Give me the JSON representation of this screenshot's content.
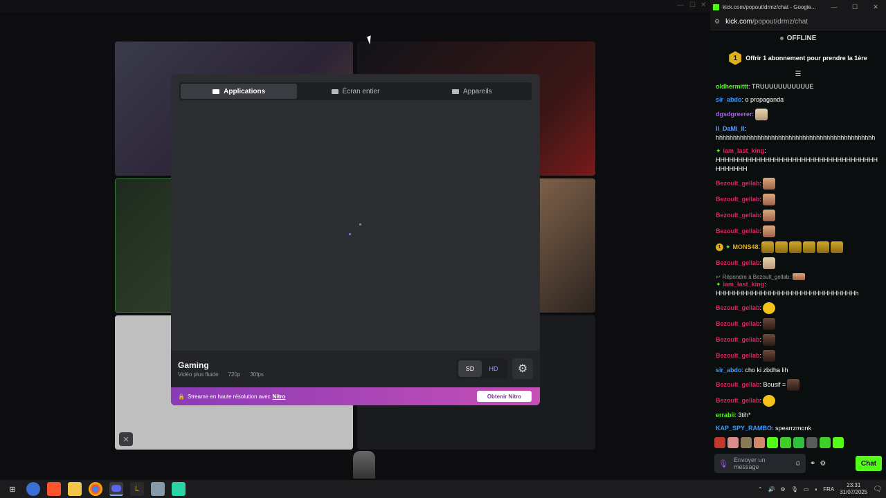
{
  "screen_share": {
    "tabs": [
      {
        "label": "Applications",
        "icon": "window-icon",
        "active": true
      },
      {
        "label": "Écran entier",
        "icon": "monitor-icon",
        "active": false
      },
      {
        "label": "Appareils",
        "icon": "camera-icon",
        "active": false
      }
    ],
    "preset": {
      "title": "Gaming",
      "subtitle": "Vidéo plus fluide",
      "resolution": "720p",
      "fps": "30fps"
    },
    "quality": {
      "sd": "SD",
      "hd": "HD",
      "selected": "SD"
    },
    "nitro": {
      "text": "Streame en haute résolution avec",
      "link": "Nitro",
      "button": "Obtenir Nitro"
    }
  },
  "chat_window": {
    "title": "kick.com/popout/drmz/chat - Google...",
    "url_host": "kick.com",
    "url_path": "/popout/drmz/chat",
    "status": "OFFLINE",
    "sub_banner": {
      "badge": "1",
      "text": "Offrir 1 abonnement pour prendre la 1ère"
    },
    "messages": [
      {
        "user": "oldhermittt",
        "color": "#53fc18",
        "text": "TRUUUUUUUUUUUE"
      },
      {
        "user": "sir_abdo",
        "color": "#3b9bff",
        "text": "o propaganda"
      },
      {
        "user": "dgsdgreerer",
        "color": "#b05cff",
        "text": ""
      },
      {
        "user": "II_DaMi_II",
        "color": "#5b9bff",
        "text": "hhhhhhhhhhhhhhhhhhhhhhhhhhhhhhhhhhhhhhhhhhhhhh"
      },
      {
        "user": "iam_last_king",
        "color": "#e0245e",
        "text": "HHHHHHHHHHHHHHHHHHHHHHHHHHHHHHHHHHHHHHHHHHH"
      },
      {
        "user": "Bezoult_gellab",
        "color": "#e0245e",
        "text": ""
      },
      {
        "user": "Bezoult_gellab",
        "color": "#e0245e",
        "text": ""
      },
      {
        "user": "Bezoult_gellab",
        "color": "#e0245e",
        "text": ""
      },
      {
        "user": "Bezoult_gellab",
        "color": "#e0245e",
        "text": ""
      },
      {
        "user": "MONS48",
        "color": "#e0b01a",
        "text": ""
      },
      {
        "user": "Bezoult_gellab",
        "color": "#e0245e",
        "text": ""
      },
      {
        "reply_to": "Répondre à Bezoult_gellab:"
      },
      {
        "user": "iam_last_king",
        "color": "#e0245e",
        "text": "HHHHHHHHHHHHHHHHHHHHHHHHHHHHHHHh"
      },
      {
        "user": "Bezoult_gellab",
        "color": "#e0245e",
        "text": ""
      },
      {
        "user": "Bezoult_gellab",
        "color": "#e0245e",
        "text": ""
      },
      {
        "user": "Bezoult_gellab",
        "color": "#e0245e",
        "text": ""
      },
      {
        "user": "Bezoult_gellab",
        "color": "#e0245e",
        "text": ""
      },
      {
        "user": "sir_abdo",
        "color": "#3b9bff",
        "text": "cho ki zbdha lih"
      },
      {
        "user": "Bezoult_gellab",
        "color": "#e0245e",
        "text": "Bousif ="
      },
      {
        "user": "Bezoult_gellab",
        "color": "#e0245e",
        "text": ""
      },
      {
        "user": "errabii",
        "color": "#53fc18",
        "text": "3tih*"
      },
      {
        "user": "KAP_SPY_RAMBO",
        "color": "#3b9bff",
        "text": "spearrzmonk"
      }
    ],
    "input_placeholder": "Envoyer un message",
    "send_button": "Chat"
  },
  "taskbar": {
    "lang": "FRA",
    "time": "23:31",
    "date": "31/07/2025"
  }
}
